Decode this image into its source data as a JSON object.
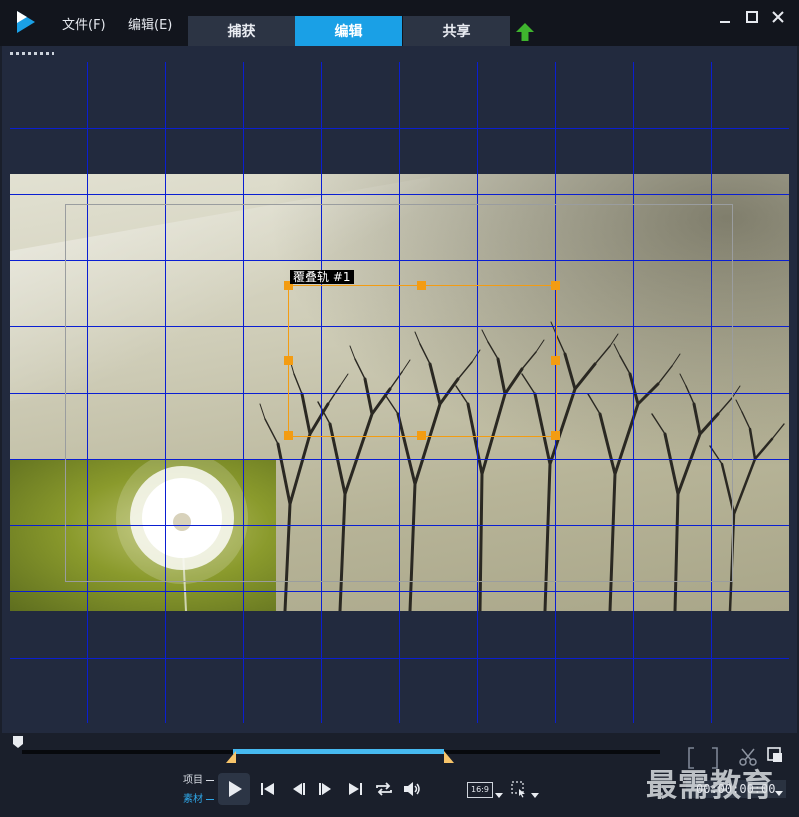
{
  "menu": {
    "file": "文件(F)",
    "edit": "编辑(E)"
  },
  "tabs": [
    {
      "label": "捕获",
      "active": false
    },
    {
      "label": "编辑",
      "active": true
    },
    {
      "label": "共享",
      "active": false
    }
  ],
  "preview": {
    "track_label": "覆叠轨 #1"
  },
  "controls": {
    "mode_project": "项目",
    "mode_clip": "素材",
    "aspect_ratio": "16:9",
    "timecode": "00:00:00:00"
  },
  "watermark": "最需教育",
  "colors": {
    "accent": "#1aa0e6",
    "grid": "#0a1ed2",
    "selection": "#f39c12",
    "trim_range": "#46b9f0"
  }
}
